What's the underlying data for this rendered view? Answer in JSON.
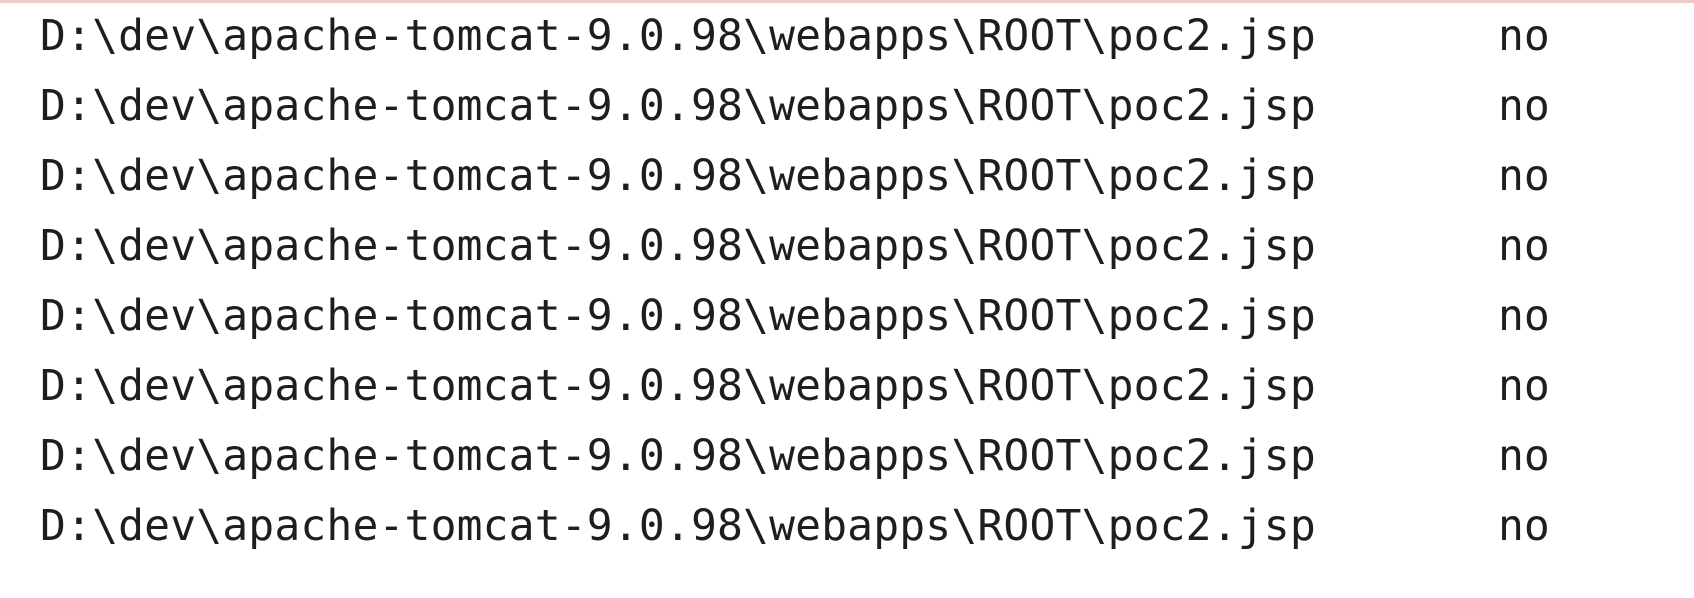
{
  "log_rows": [
    {
      "path": "D:\\dev\\apache-tomcat-9.0.98\\webapps\\ROOT\\poc2.jsp",
      "status": "no"
    },
    {
      "path": "D:\\dev\\apache-tomcat-9.0.98\\webapps\\ROOT\\poc2.jsp",
      "status": "no"
    },
    {
      "path": "D:\\dev\\apache-tomcat-9.0.98\\webapps\\ROOT\\poc2.jsp",
      "status": "no"
    },
    {
      "path": "D:\\dev\\apache-tomcat-9.0.98\\webapps\\ROOT\\poc2.jsp",
      "status": "no"
    },
    {
      "path": "D:\\dev\\apache-tomcat-9.0.98\\webapps\\ROOT\\poc2.jsp",
      "status": "no"
    },
    {
      "path": "D:\\dev\\apache-tomcat-9.0.98\\webapps\\ROOT\\poc2.jsp",
      "status": "no"
    },
    {
      "path": "D:\\dev\\apache-tomcat-9.0.98\\webapps\\ROOT\\poc2.jsp",
      "status": "no"
    },
    {
      "path": "D:\\dev\\apache-tomcat-9.0.98\\webapps\\ROOT\\poc2.jsp",
      "status": "no"
    }
  ],
  "colors": {
    "text": "#1e1e1e",
    "background": "#ffffff",
    "top_border": "#f4c8c8"
  }
}
